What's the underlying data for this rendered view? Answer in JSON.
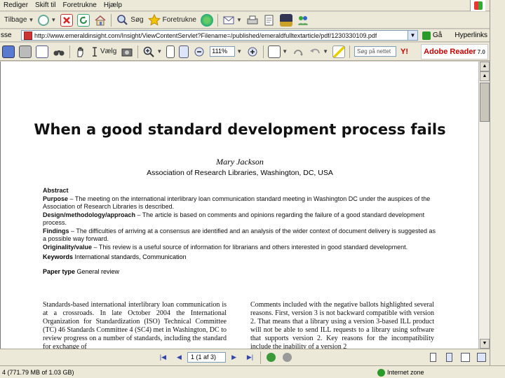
{
  "menu": {
    "items": [
      "Rediger",
      "Skift til",
      "Foretrukne",
      "Hjælp"
    ]
  },
  "toolbar": {
    "back_label": "Tilbage",
    "search_label": "Søg",
    "favorites_label": "Foretrukne"
  },
  "address": {
    "label": "sse",
    "url": "http://www.emeraldinsight.com/Insight/ViewContentServlet?Filename=/published/emeraldfulltextarticle/pdf/1230330109.pdf",
    "go_label": "Gå",
    "links_label": "Hyperlinks"
  },
  "acrobat": {
    "select_label": "Vælg",
    "zoom": "111%",
    "search_placeholder": "Søg på nettet",
    "brand": "Adobe Reader",
    "version": "7.0"
  },
  "document": {
    "title": "When a good standard development process fails",
    "author": "Mary Jackson",
    "affiliation": "Association of Research Libraries, Washington, DC, USA",
    "abstract_heading": "Abstract",
    "purpose_label": "Purpose",
    "purpose_text": " – The meeting on the international interlibrary loan communication standard meeting in Washington DC under the auspices of the Association of Research Libraries is described.",
    "design_label": "Design/methodology/approach",
    "design_text": " – The article is based on comments and opinions regarding the failure of a good standard development process.",
    "findings_label": "Findings",
    "findings_text": " – The difficulties of arriving at a consensus are identified and an analysis of the wider context of document delivery is suggested as a possible way forward.",
    "originality_label": "Originality/value",
    "originality_text": " – This review is a useful source of information for librarians and others interested in good standard development.",
    "keywords_label": "Keywords",
    "keywords_text": " International standards, Communication",
    "paper_type_label": "Paper type",
    "paper_type_text": " General review",
    "col_left": "Standards-based international interlibrary loan communication is at a crossroads. In late October 2004 the International Organization for Standardization (ISO) Technical Committee (TC) 46 Standards Committee 4 (SC4) met in Washington, DC to review progress on a number of standards, including the standard for exchange of",
    "col_right": "Comments included with the negative ballots highlighted several reasons. First, version 3 is not backward compatible with version 2. That means that a library using a version 3-based ILL product will not be able to send ILL requests to a library using software that supports version 2. Key reasons for the incompatibility include the inability of a version 2"
  },
  "nav": {
    "page_indicator": "1 (1 af 3)"
  },
  "status": {
    "text": "4 (771.79 MB of 1.03 GB)",
    "zone": "Internet zone"
  },
  "colors": {
    "chrome": "#ece9d8",
    "field_border": "#7f9db9",
    "adobe_red": "#cc0000"
  }
}
